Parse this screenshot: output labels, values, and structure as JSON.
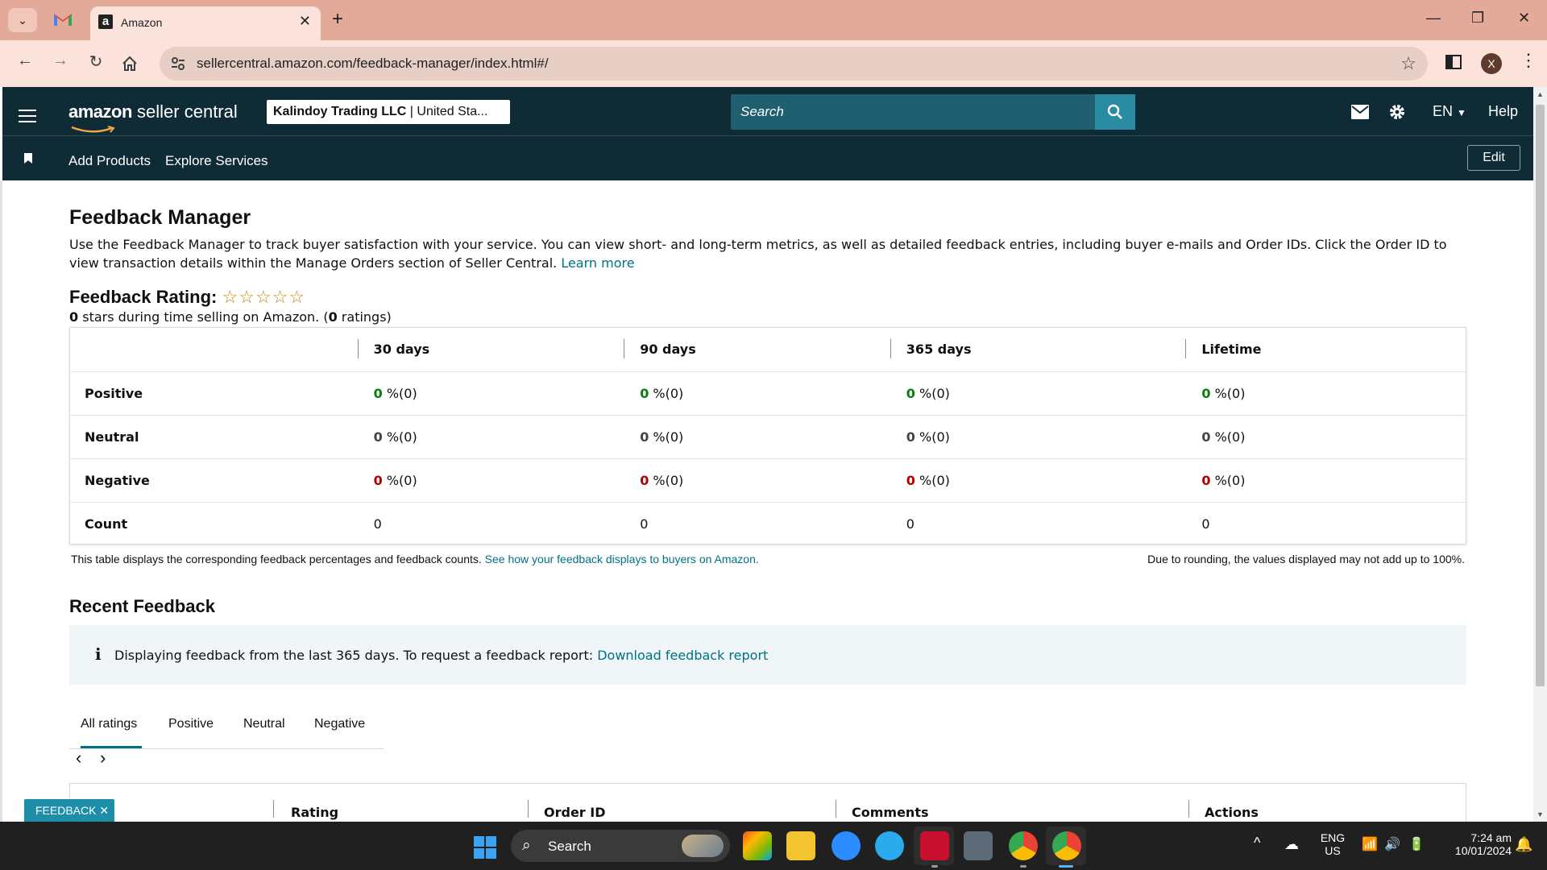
{
  "browser": {
    "tab_title": "Amazon",
    "favicon_letter": "a",
    "url": "sellercentral.amazon.com/feedback-manager/index.html#/",
    "profile_initial": "X"
  },
  "header": {
    "logo_brand": "amazon",
    "logo_product": " seller central",
    "account_name": "Kalindoy Trading LLC",
    "account_region": " | United Sta...",
    "search_placeholder": "Search",
    "language": "EN",
    "help": "Help",
    "nav_links": [
      "Add Products",
      "Explore Services"
    ],
    "edit_label": "Edit"
  },
  "page": {
    "title": "Feedback Manager",
    "intro": "Use the Feedback Manager to track buyer satisfaction with your service. You can view short- and long-term metrics, as well as detailed feedback entries, including buyer e-mails and Order IDs. Click the Order ID to view transaction details within the Manage Orders section of Seller Central. ",
    "learn_more": "Learn more",
    "rating_label": "Feedback Rating:",
    "rating_stars": "☆☆☆☆☆",
    "rating_summary": {
      "stars_count": "0",
      "middle": " stars during time selling on Amazon. (",
      "ratings_count": "0",
      "end": " ratings)"
    }
  },
  "metrics_table": {
    "columns": [
      "30 days",
      "90 days",
      "365 days",
      "Lifetime"
    ],
    "rows": [
      {
        "label": "Positive",
        "kind": "pos",
        "cells": [
          {
            "n": "0",
            "s": " %(0)"
          },
          {
            "n": "0",
            "s": " %(0)"
          },
          {
            "n": "0",
            "s": " %(0)"
          },
          {
            "n": "0",
            "s": " %(0)"
          }
        ]
      },
      {
        "label": "Neutral",
        "kind": "neu",
        "cells": [
          {
            "n": "0",
            "s": " %(0)"
          },
          {
            "n": "0",
            "s": " %(0)"
          },
          {
            "n": "0",
            "s": " %(0)"
          },
          {
            "n": "0",
            "s": " %(0)"
          }
        ]
      },
      {
        "label": "Negative",
        "kind": "neg",
        "cells": [
          {
            "n": "0",
            "s": " %(0)"
          },
          {
            "n": "0",
            "s": " %(0)"
          },
          {
            "n": "0",
            "s": " %(0)"
          },
          {
            "n": "0",
            "s": " %(0)"
          }
        ]
      },
      {
        "label": "Count",
        "kind": "count",
        "cells": [
          {
            "n": "",
            "s": "0"
          },
          {
            "n": "",
            "s": "0"
          },
          {
            "n": "",
            "s": "0"
          },
          {
            "n": "",
            "s": "0"
          }
        ]
      }
    ],
    "note_left": "This table displays the corresponding feedback percentages and feedback counts. ",
    "note_link": "See how your feedback displays to buyers on Amazon.",
    "note_right": "Due to rounding, the values displayed may not add up to 100%."
  },
  "recent": {
    "title": "Recent Feedback",
    "info_text": "Displaying feedback from the last 365 days. To request a feedback report: ",
    "info_link": "Download feedback report",
    "tabs": [
      "All ratings",
      "Positive",
      "Neutral",
      "Negative"
    ],
    "columns": [
      "Rating",
      "Order ID",
      "Comments",
      "Actions"
    ],
    "partial_first_column": ":",
    "feedback_pill": "FEEDBACK ✕"
  },
  "taskbar": {
    "search_label": "Search",
    "lang_top": "ENG",
    "lang_bottom": "US",
    "time": "7:24 am",
    "date": "10/01/2024"
  },
  "colors": {
    "header_bg": "#0e2b36",
    "link": "#007185",
    "positive": "#067d0e",
    "negative": "#b00000",
    "tab_strip": "#e4aa99"
  }
}
